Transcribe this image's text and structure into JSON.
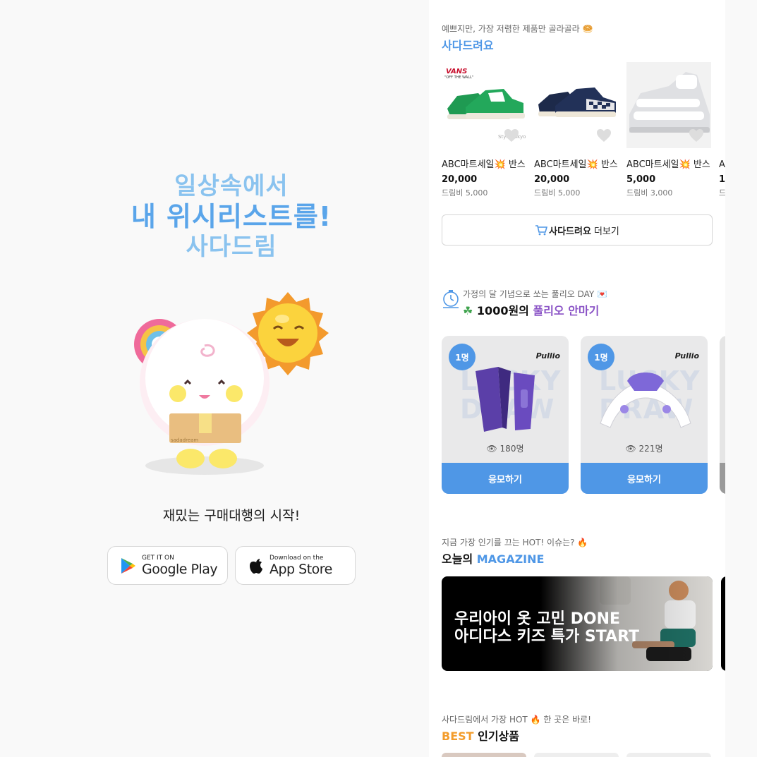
{
  "promo": {
    "line1": "일상속에서",
    "line2": "내 위시리스트를!",
    "line3": "사다드림",
    "tagline": "재밌는 구매대행의 시작!",
    "google_small": "GET IT ON",
    "google_big": "Google Play",
    "apple_small": "Download on the",
    "apple_big": "App Store",
    "mascot_box_text": "sadadream"
  },
  "sadadream": {
    "eyebrow": "예쁘지만, 가장 저렴한 제품만 골라골라 🥯",
    "title": "사다드려요",
    "products": [
      {
        "name": "ABC마트세일💥 반스 올드스쿨",
        "price": "20,000",
        "fee": "드림비 5,000",
        "logo": "VANS",
        "logo_sub": "\"OFF THE WALL\"",
        "watermark": "Style Tokyo"
      },
      {
        "name": "ABC마트세일💥 반스 체커보드",
        "price": "20,000",
        "fee": "드림비 5,000"
      },
      {
        "name": "ABC마트세일💥 반스 샌들",
        "price": "5,000",
        "fee": "드림비 3,000"
      },
      {
        "name": "ABC마트세일💥 반스",
        "price": "1",
        "fee": "드"
      }
    ],
    "more_bold": "사다드려요",
    "more_rest": "더보기"
  },
  "pullio": {
    "eyebrow": "가정의 달 기념으로 쏘는 풀리오 DAY 💌",
    "title_prefix": "1000원의",
    "title_accent": "풀리오 안마기",
    "cards": [
      {
        "badge": "1명",
        "brand": "Pullio",
        "watermark": "LUCKY DRAW",
        "views": "180명",
        "apply": "응모하기"
      },
      {
        "badge": "1명",
        "brand": "Pullio",
        "watermark": "LUCKY DRAW",
        "views": "221명",
        "apply": "응모하기"
      }
    ]
  },
  "magazine": {
    "eyebrow": "지금 가장 인기를 끄는 HOT! 이슈는? 🔥",
    "title_prefix": "오늘의",
    "title_accent": "MAGAZINE",
    "banner_line1": "우리아이 옷 고민 DONE",
    "banner_line2": "아디다스 키즈 특가 START"
  },
  "best": {
    "eyebrow": "사다드림에서 가장 HOT 🔥 한 곳은 바로!",
    "title_accent": "BEST",
    "title_rest": "인기상품"
  },
  "colors": {
    "brand_blue": "#4f97e6",
    "light_blue": "#8ac3ef",
    "purple": "#8a53c6",
    "orange": "#f39c2b"
  }
}
